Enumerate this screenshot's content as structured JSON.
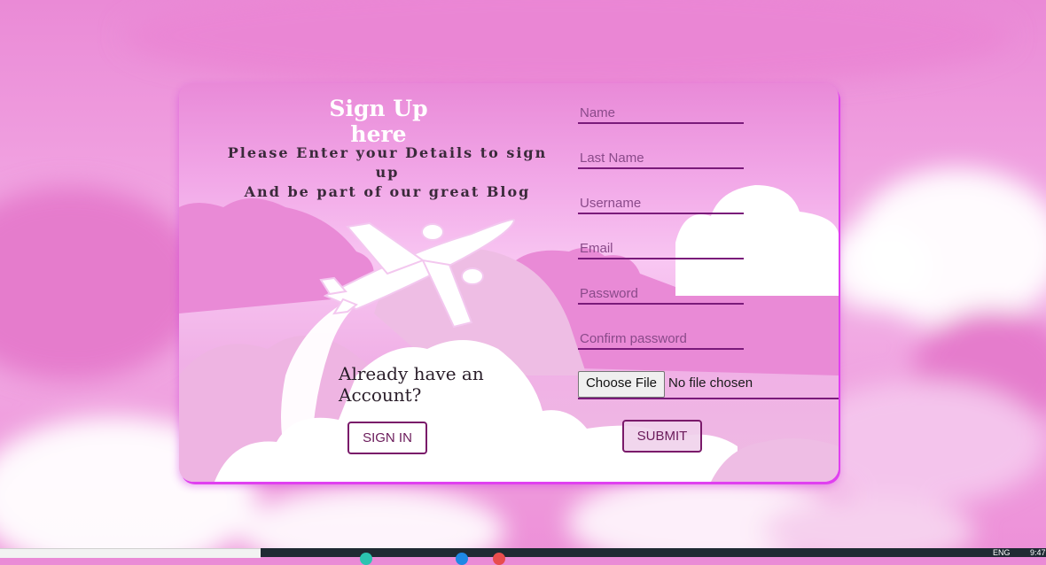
{
  "signup": {
    "title": "Sign Up here",
    "subtitle_line1": "Please Enter your Details to sign up",
    "subtitle_line2": "And be part of our great Blog",
    "already_line1": "Already have an",
    "already_line2": "Account?",
    "signin_label": "SIGN IN",
    "submit_label": "SUBMIT"
  },
  "form": {
    "name_placeholder": "Name",
    "lastname_placeholder": "Last Name",
    "username_placeholder": "Username",
    "email_placeholder": "Email",
    "password_placeholder": "Password",
    "confirm_placeholder": "Confirm password",
    "file_button": "Choose File",
    "file_status": "No file chosen"
  },
  "taskbar": {
    "lang": "ENG",
    "time": "9:47"
  },
  "colors": {
    "accent": "#7a1a7a",
    "background": "#ea8ad6",
    "glow": "#e040f0"
  }
}
